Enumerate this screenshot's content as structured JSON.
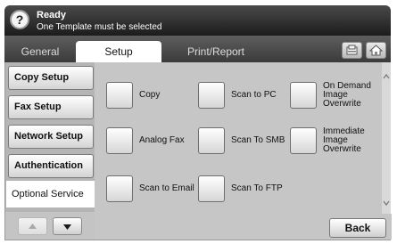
{
  "status": {
    "help_symbol": "?",
    "title": "Ready",
    "message": "One Template must be selected"
  },
  "tabs": [
    {
      "label": "General",
      "selected": false
    },
    {
      "label": "Setup",
      "selected": true
    },
    {
      "label": "Print/Report",
      "selected": false
    }
  ],
  "toolbar_icons": [
    "tray-icon",
    "home-icon"
  ],
  "sidebar": {
    "items": [
      {
        "label": "Copy Setup",
        "selected": false
      },
      {
        "label": "Fax Setup",
        "selected": false
      },
      {
        "label": "Network Setup",
        "selected": false
      },
      {
        "label": "Authentication",
        "selected": false
      },
      {
        "label": "Optional Service",
        "selected": true
      }
    ]
  },
  "options": [
    {
      "label": "Copy"
    },
    {
      "label": "Scan to PC"
    },
    {
      "label": "On Demand Image Overwrite"
    },
    {
      "label": "Analog Fax"
    },
    {
      "label": "Scan To SMB"
    },
    {
      "label": "Immediate Image Overwrite"
    },
    {
      "label": "Scan to Email"
    },
    {
      "label": "Scan To FTP"
    }
  ],
  "buttons": {
    "back": "Back"
  },
  "icons": {
    "scroll_up": "^",
    "scroll_down": "v"
  }
}
